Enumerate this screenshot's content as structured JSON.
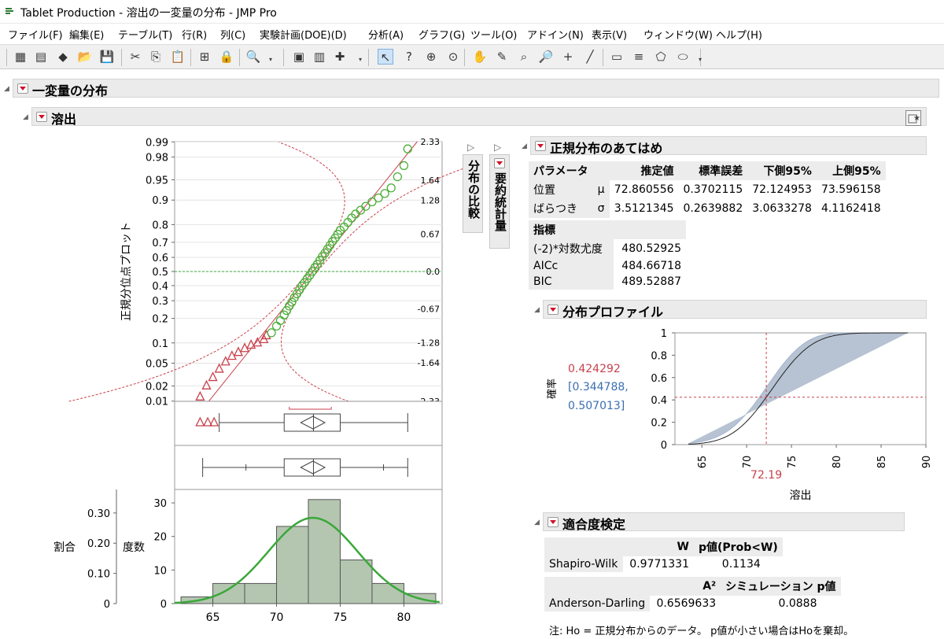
{
  "window": {
    "title": "Tablet Production - 溶出の一変量の分布 - JMP Pro"
  },
  "menu": [
    "ファイル(F)",
    "編集(E)",
    "テーブル(T)",
    "行(R)",
    "列(C)",
    "実験計画(DOE)(D)",
    "分析(A)",
    "グラフ(G)",
    "ツール(O)",
    "アドイン(N)",
    "表示(V)",
    "ウィンドウ(W)",
    "ヘルプ(H)"
  ],
  "toolbar": {
    "icons": [
      "new-data-table-icon",
      "new-script-icon",
      "python-icon",
      "open-icon",
      "save-icon",
      "cut-icon",
      "copy-icon",
      "paste-icon",
      "formula-icon",
      "lock-icon",
      "search-icon",
      "journal-icon",
      "data-view-icon",
      "add-icon",
      "arrow-tool-icon",
      "help-tool-icon",
      "selection-tool-icon",
      "crosshair-tool-icon",
      "hand-tool-icon",
      "brush-tool-icon",
      "lasso-tool-icon",
      "magnifier-tool-icon",
      "plus-tool-icon",
      "line-tool-icon",
      "annotate-tool-icon",
      "shape-tool-icon",
      "polygon-tool-icon",
      "oval-tool-icon"
    ]
  },
  "report": {
    "title": "一変量の分布",
    "variable": "溶出",
    "tabs": {
      "compare": "分布の比較",
      "summary": "要約統計量"
    }
  },
  "quantile_plot": {
    "ylabel": "正規分位点プロット",
    "probs": [
      "0.99",
      "0.98",
      "0.95",
      "0.9",
      "0.8",
      "0.7",
      "0.6",
      "0.5",
      "0.4",
      "0.3",
      "0.2",
      "0.1",
      "0.05",
      "0.02",
      "0.01"
    ],
    "zlabels": [
      "2.33",
      "1.64",
      "1.28",
      "0.67",
      "0.0",
      "-0.67",
      "-1.28",
      "-1.64",
      "-2.33"
    ]
  },
  "histogram": {
    "ylabel_count": "度数",
    "ylabel_prop": "割合",
    "prop_ticks": [
      "0.30",
      "0.20",
      "0.10",
      "0"
    ],
    "count_ticks": [
      "30",
      "20",
      "10",
      "0"
    ],
    "x_ticks": [
      "65",
      "70",
      "75",
      "80"
    ]
  },
  "normal_fit": {
    "title": "正規分布のあてはめ",
    "headers": [
      "パラメータ",
      "",
      "推定値",
      "標準誤差",
      "下側95%",
      "上側95%"
    ],
    "rows": [
      [
        "位置",
        "μ",
        "72.860556",
        "0.3702115",
        "72.124953",
        "73.596158"
      ],
      [
        "ばらつき",
        "σ",
        "3.5121345",
        "0.2639882",
        "3.0633278",
        "4.1162418"
      ]
    ],
    "measure_header": "指標",
    "measures": [
      [
        "(-2)*対数尤度",
        "480.52925"
      ],
      [
        "AICc",
        "484.66718"
      ],
      [
        "BIC",
        "489.52887"
      ]
    ]
  },
  "profiler": {
    "title": "分布プロファイル",
    "ylabel": "確率",
    "xlabel": "溶出",
    "prob_value": "0.424292",
    "ci_line1": "[0.344788,",
    "ci_line2": "0.507013]",
    "x_value": "72.19",
    "y_ticks": [
      "1",
      "0.8",
      "0.6",
      "0.4",
      "0.2",
      "0"
    ],
    "x_ticks": [
      "65",
      "70",
      "75",
      "80",
      "85",
      "90"
    ]
  },
  "gof": {
    "title": "適合度検定",
    "sw_headers": [
      "",
      "W",
      "p値(Prob<W)"
    ],
    "sw_row": [
      "Shapiro-Wilk",
      "0.9771331",
      "0.1134"
    ],
    "ad_headers": [
      "",
      "A²",
      "シミュレーション p値"
    ],
    "ad_row": [
      "Anderson-Darling",
      "0.6569633",
      "0.0888"
    ],
    "note": "注: Ho = 正規分布からのデータ。 p値が小さい場合はHoを棄却。"
  },
  "chart_data": [
    {
      "type": "scatter",
      "title": "正規分位点プロット",
      "ylabel": "正規分位点プロット",
      "xlim": [
        62,
        83
      ],
      "ylim": [
        -2.33,
        2.33
      ],
      "series": [
        {
          "name": "",
          "marker": "triangle",
          "color": "#c8414b",
          "x": [
            64.0,
            64.5,
            65.0,
            65.5,
            66.0,
            66.5,
            67.0,
            67.5,
            68.0,
            68.5,
            69.0,
            69.2
          ],
          "y": [
            -2.25,
            -2.05,
            -1.9,
            -1.75,
            -1.62,
            -1.52,
            -1.45,
            -1.38,
            -1.32,
            -1.28,
            -1.22,
            -1.15
          ]
        },
        {
          "name": "",
          "marker": "circle",
          "color": "#4caf3a",
          "x": [
            69.6,
            70.0,
            70.3,
            70.6,
            70.8,
            71.0,
            71.2,
            71.4,
            71.6,
            71.8,
            72.0,
            72.2,
            72.4,
            72.6,
            72.8,
            73.0,
            73.2,
            73.4,
            73.6,
            73.8,
            74.0,
            74.2,
            74.4,
            74.6,
            74.8,
            75.0,
            75.3,
            75.6,
            75.9,
            76.2,
            76.6,
            77.0,
            77.5,
            78.0,
            78.5,
            79.0,
            79.5,
            80.0,
            80.3
          ],
          "y": [
            -1.1,
            -0.98,
            -0.88,
            -0.78,
            -0.7,
            -0.62,
            -0.55,
            -0.47,
            -0.4,
            -0.33,
            -0.26,
            -0.2,
            -0.13,
            -0.07,
            0.0,
            0.07,
            0.13,
            0.2,
            0.27,
            0.33,
            0.4,
            0.47,
            0.54,
            0.6,
            0.67,
            0.74,
            0.8,
            0.88,
            0.96,
            1.03,
            1.1,
            1.17,
            1.25,
            1.32,
            1.4,
            1.5,
            1.7,
            1.9,
            2.2
          ]
        }
      ]
    },
    {
      "type": "bar",
      "title": "",
      "xlabel": "",
      "ylabel": "度数",
      "xlim": [
        62,
        83
      ],
      "ylim": [
        0,
        34
      ],
      "bins": [
        [
          62.5,
          65
        ],
        [
          65,
          67.5
        ],
        [
          67.5,
          70
        ],
        [
          70,
          72.5
        ],
        [
          72.5,
          75
        ],
        [
          75,
          77.5
        ],
        [
          77.5,
          80
        ],
        [
          80,
          82.5
        ]
      ],
      "values": [
        2,
        6,
        6,
        23,
        31,
        13,
        6,
        3
      ]
    },
    {
      "type": "line",
      "title": "分布プロファイル",
      "xlabel": "溶出",
      "ylabel": "確率",
      "xlim": [
        62,
        90
      ],
      "ylim": [
        0,
        1
      ],
      "mu": 72.860556,
      "sigma": 3.5121345,
      "current": {
        "x": 72.19,
        "y": 0.424292
      }
    }
  ]
}
